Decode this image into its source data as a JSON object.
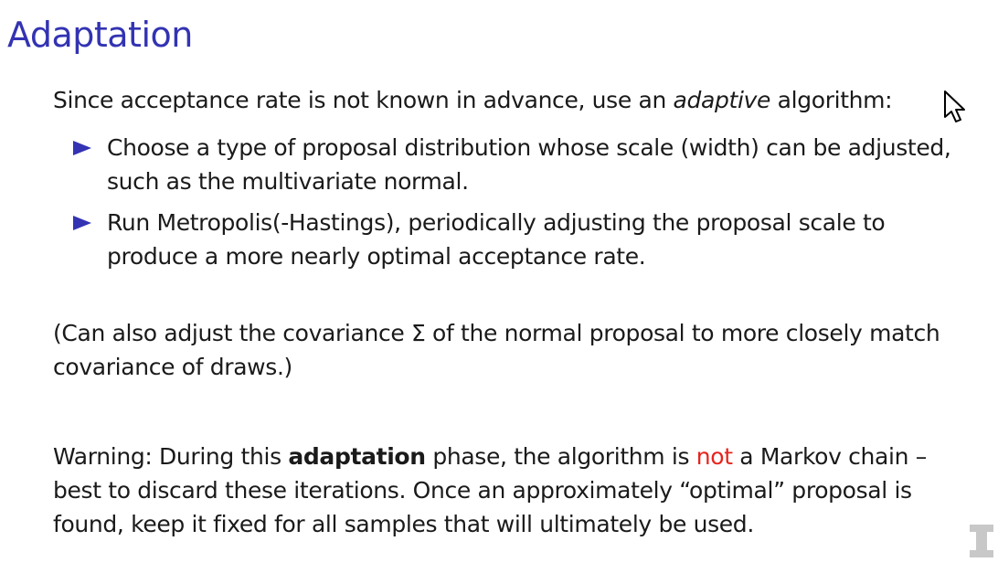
{
  "title": "Adaptation",
  "intro": {
    "before": "Since acceptance rate is not known in advance, use an ",
    "emph": "adaptive",
    "after": " algorithm:"
  },
  "bullets": [
    {
      "line1": "Choose a type of proposal distribution whose scale (width) can be adjusted,",
      "line2": "such as the multivariate normal."
    },
    {
      "line1": "Run Metropolis(-Hastings), periodically adjusting the proposal scale to",
      "line2": "produce a more nearly optimal acceptance rate."
    }
  ],
  "note": {
    "line1": "(Can also adjust the covariance Σ of the normal proposal to more closely match",
    "line2": "covariance of draws.)"
  },
  "warning": {
    "line1_before": "Warning: During this ",
    "line1_bold": "adaptation",
    "line1_mid": " phase, the algorithm is ",
    "line1_red": "not",
    "line1_after": " a Markov chain –",
    "line2": "best to discard these iterations. Once an approximately “optimal” proposal is",
    "line3": "found, keep it fixed for all samples that will ultimately be used."
  },
  "colors": {
    "title": "#3333b3",
    "bullet": "#3333b3",
    "highlight": "#e8231c"
  },
  "icons": {
    "pointer": "mouse-pointer-icon",
    "logo": "watermark-logo"
  }
}
